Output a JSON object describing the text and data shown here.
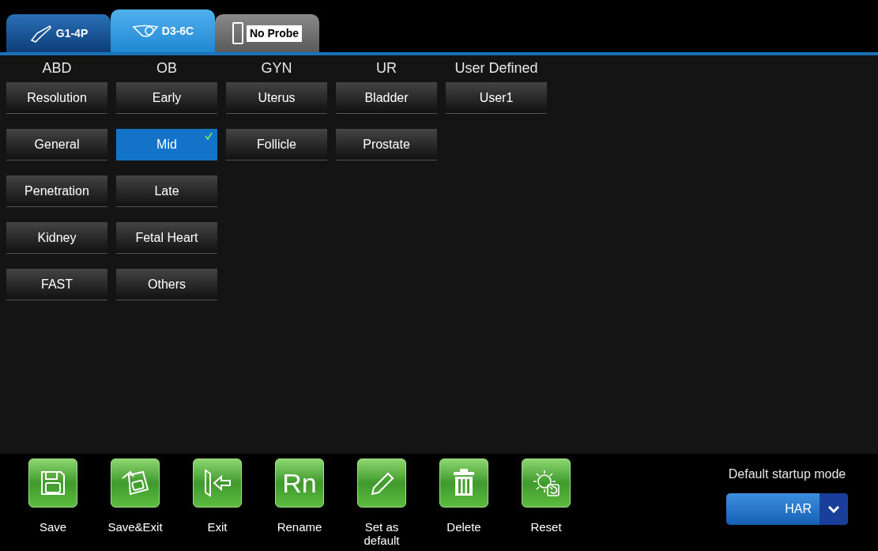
{
  "probe_tabs": [
    {
      "label": "G1-4P",
      "kind": "convex",
      "selected": false
    },
    {
      "label": "D3-6C",
      "kind": "volume",
      "selected": true
    },
    {
      "label": "No Probe",
      "kind": "empty",
      "selected": false
    }
  ],
  "columns": [
    {
      "header": "ABD",
      "presets": [
        {
          "label": "Resolution",
          "selected": false
        },
        {
          "label": "General",
          "selected": false
        },
        {
          "label": "Penetration",
          "selected": false
        },
        {
          "label": "Kidney",
          "selected": false
        },
        {
          "label": "FAST",
          "selected": false
        }
      ]
    },
    {
      "header": "OB",
      "presets": [
        {
          "label": "Early",
          "selected": false
        },
        {
          "label": "Mid",
          "selected": true
        },
        {
          "label": "Late",
          "selected": false
        },
        {
          "label": "Fetal Heart",
          "selected": false
        },
        {
          "label": "Others",
          "selected": false
        }
      ]
    },
    {
      "header": "GYN",
      "presets": [
        {
          "label": "Uterus",
          "selected": false
        },
        {
          "label": "Follicle",
          "selected": false
        }
      ]
    },
    {
      "header": "UR",
      "presets": [
        {
          "label": "Bladder",
          "selected": false
        },
        {
          "label": "Prostate",
          "selected": false
        }
      ]
    },
    {
      "header": "User Defined",
      "presets": [
        {
          "label": "User1",
          "selected": false
        }
      ]
    }
  ],
  "actions": [
    {
      "label": "Save",
      "kind": "save"
    },
    {
      "label": "Save&Exit",
      "kind": "save_exit"
    },
    {
      "label": "Exit",
      "kind": "exit"
    },
    {
      "label": "Rename",
      "kind": "rename",
      "glyph": "Rn"
    },
    {
      "label": "Set as default",
      "kind": "edit"
    },
    {
      "label": "Delete",
      "kind": "delete"
    },
    {
      "label": "Reset",
      "kind": "reset"
    }
  ],
  "startup": {
    "label": "Default startup mode",
    "value": "HAR"
  }
}
